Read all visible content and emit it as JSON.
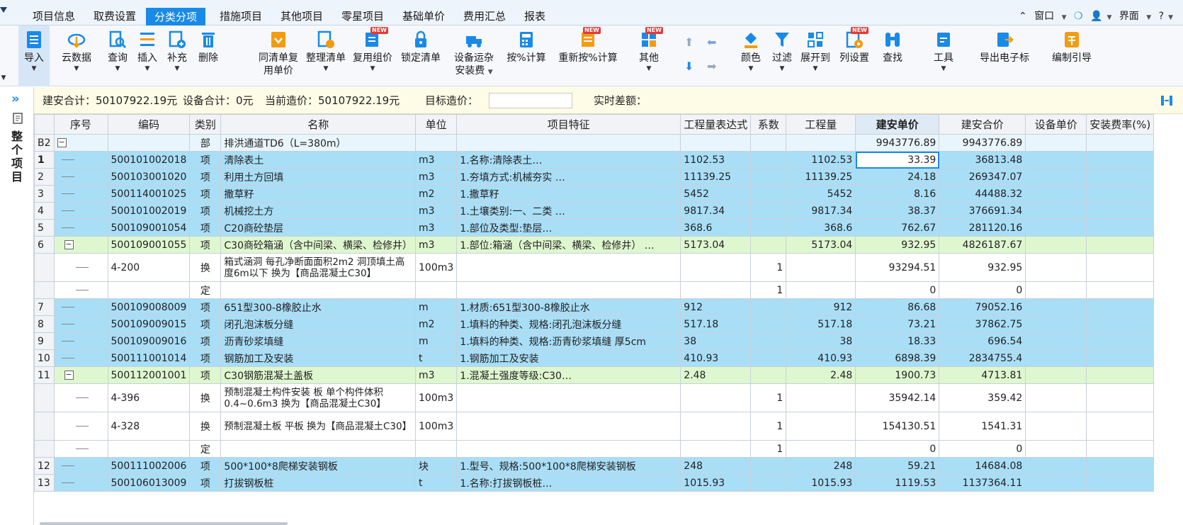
{
  "menu": {
    "tabs": [
      "项目信息",
      "取费设置",
      "分类分项",
      "措施项目",
      "其他项目",
      "零星项目",
      "基础单价",
      "费用汇总",
      "报表"
    ],
    "active_index": 2,
    "right": {
      "window": "窗口",
      "interface": "界面"
    }
  },
  "toolbar": {
    "import": "导入",
    "cloud": "云数据",
    "query": "查询",
    "insert": "插入",
    "supplement": "补充",
    "delete": "删除",
    "same_price_l1": "同清单复",
    "same_price_l2": "用单价",
    "organize": "整理清单",
    "reuse": "复用组价",
    "lock": "锁定清单",
    "equip_l1": "设备运杂",
    "equip_l2": "安装费",
    "percent": "按%计算",
    "recalc": "重新按%计算",
    "other": "其他",
    "color": "颜色",
    "filter": "过滤",
    "expand": "展开到",
    "columns": "列设置",
    "find": "查找",
    "tools": "工具",
    "export": "导出电子标",
    "guide": "编制引导",
    "new_badge": "NEW"
  },
  "summary": {
    "jian_an_label": "建安合计：",
    "jian_an_value": "50107922.19元",
    "equip_label": "设备合计：",
    "equip_value": "0元",
    "current_label": "当前造价：",
    "current_value": "50107922.19元",
    "target_label": "目标造价：",
    "diff_label": "实时差额："
  },
  "sidebar": {
    "label": "整个项目"
  },
  "table": {
    "headers": [
      "",
      "序号",
      "编码",
      "类别",
      "名称",
      "单位",
      "项目特征",
      "工程量表达式",
      "系数",
      "工程量",
      "建安单价",
      "建安合价",
      "设备单价",
      "安装费率(%)"
    ],
    "rows": [
      {
        "type": "bu",
        "rn": "B2",
        "seq": "",
        "code": "",
        "cat": "部",
        "name": "排洪通道TD6（L=380m）",
        "unit": "",
        "feature": "",
        "expr": "",
        "coef": "",
        "qty": "",
        "price": "9943776.89",
        "total": "9943776.89"
      },
      {
        "type": "xiang",
        "rn": "1",
        "code": "500101002018",
        "cat": "项",
        "name": "清除表土",
        "unit": "m3",
        "feature": "1.名称:清除表土…",
        "expr": "1102.53",
        "coef": "",
        "qty": "1102.53",
        "price": "33.39",
        "total": "36813.48"
      },
      {
        "type": "xiang",
        "rn": "2",
        "code": "500103001020",
        "cat": "项",
        "name": "利用土方回填",
        "unit": "m3",
        "feature": "1.夯填方式:机械夯实 …",
        "expr": "11139.25",
        "coef": "",
        "qty": "11139.25",
        "price": "24.18",
        "total": "269347.07"
      },
      {
        "type": "xiang",
        "rn": "3",
        "code": "500114001025",
        "cat": "项",
        "name": "撒草籽",
        "unit": "m2",
        "feature": "1.撒草籽",
        "expr": "5452",
        "coef": "",
        "qty": "5452",
        "price": "8.16",
        "total": "44488.32"
      },
      {
        "type": "xiang",
        "rn": "4",
        "code": "500101002019",
        "cat": "项",
        "name": "机械挖土方",
        "unit": "m3",
        "feature": "1.土壤类别:一、二类 …",
        "expr": "9817.34",
        "coef": "",
        "qty": "9817.34",
        "price": "38.37",
        "total": "376691.34"
      },
      {
        "type": "xiang",
        "rn": "5",
        "code": "500109001054",
        "cat": "项",
        "name": "C20商砼垫层",
        "unit": "m3",
        "feature": "1.部位及类型:垫层…",
        "expr": "368.6",
        "coef": "",
        "qty": "368.6",
        "price": "762.67",
        "total": "281120.16"
      },
      {
        "type": "green",
        "rn": "6",
        "code": "500109001055",
        "cat": "项",
        "name": "C30商砼箱涵（含中间梁、横梁、检修井）",
        "unit": "m3",
        "feature": "1.部位:箱涵（含中间梁、横梁、检修井） …",
        "expr": "5173.04",
        "coef": "",
        "qty": "5173.04",
        "price": "932.95",
        "total": "4826187.67"
      },
      {
        "type": "huan",
        "tall": true,
        "rn": "",
        "code": "4-200",
        "cat": "换",
        "name": "箱式涵洞 每孔净断面面积2m2 洞顶填土高度6m以下  换为【商品混凝土C30】",
        "unit": "100m3",
        "feature": "",
        "expr": "",
        "coef": "1",
        "qty": "",
        "price": "93294.51",
        "total": "932.95"
      },
      {
        "type": "huan",
        "rn": "",
        "code": "",
        "cat": "定",
        "name": "",
        "unit": "",
        "feature": "",
        "expr": "",
        "coef": "1",
        "qty": "",
        "price": "0",
        "total": "0"
      },
      {
        "type": "xiang",
        "rn": "7",
        "code": "500109008009",
        "cat": "项",
        "name": "651型300-8橡胶止水",
        "unit": "m",
        "feature": "1.材质:651型300-8橡胶止水",
        "expr": "912",
        "coef": "",
        "qty": "912",
        "price": "86.68",
        "total": "79052.16"
      },
      {
        "type": "xiang",
        "rn": "8",
        "code": "500109009015",
        "cat": "项",
        "name": "闭孔泡沫板分缝",
        "unit": "m2",
        "feature": "1.填料的种类、规格:闭孔泡沫板分缝",
        "expr": "517.18",
        "coef": "",
        "qty": "517.18",
        "price": "73.21",
        "total": "37862.75"
      },
      {
        "type": "xiang",
        "rn": "9",
        "code": "500109009016",
        "cat": "项",
        "name": "沥青砂浆填缝",
        "unit": "m",
        "feature": "1.填料的种类、规格:沥青砂浆填缝 厚5cm",
        "expr": "38",
        "coef": "",
        "qty": "38",
        "price": "18.33",
        "total": "696.54"
      },
      {
        "type": "xiang",
        "rn": "10",
        "code": "500111001014",
        "cat": "项",
        "name": "钢筋加工及安装",
        "unit": "t",
        "feature": "1.钢筋加工及安装",
        "expr": "410.93",
        "coef": "",
        "qty": "410.93",
        "price": "6898.39",
        "total": "2834755.4"
      },
      {
        "type": "green",
        "rn": "11",
        "code": "500112001001",
        "cat": "项",
        "name": "C30钢筋混凝土盖板",
        "unit": "m3",
        "feature": "1.混凝土强度等级:C30…",
        "expr": "2.48",
        "coef": "",
        "qty": "2.48",
        "price": "1900.73",
        "total": "4713.81"
      },
      {
        "type": "huan",
        "tall": true,
        "rn": "",
        "code": "4-396",
        "cat": "换",
        "name": "预制混凝土构件安装 板 单个构件体积0.4~0.6m3  换为【商品混凝土C30】",
        "unit": "100m3",
        "feature": "",
        "expr": "",
        "coef": "1",
        "qty": "",
        "price": "35942.14",
        "total": "359.42"
      },
      {
        "type": "huan",
        "tall": true,
        "rn": "",
        "code": "4-328",
        "cat": "换",
        "name": "预制混凝土板 平板  换为【商品混凝土C30】",
        "unit": "100m3",
        "feature": "",
        "expr": "",
        "coef": "1",
        "qty": "",
        "price": "154130.51",
        "total": "1541.31"
      },
      {
        "type": "huan",
        "rn": "",
        "code": "",
        "cat": "定",
        "name": "",
        "unit": "",
        "feature": "",
        "expr": "",
        "coef": "1",
        "qty": "",
        "price": "0",
        "total": "0"
      },
      {
        "type": "xiang",
        "rn": "12",
        "code": "500111002006",
        "cat": "项",
        "name": "500*100*8爬梯安装钢板",
        "unit": "块",
        "feature": "1.型号、规格:500*100*8爬梯安装钢板",
        "expr": "248",
        "coef": "",
        "qty": "248",
        "price": "59.21",
        "total": "14684.08"
      },
      {
        "type": "xiang",
        "rn": "13",
        "code": "500106013009",
        "cat": "项",
        "name": "打拔钢板桩",
        "unit": "t",
        "feature": "1.名称:打拔钢板桩…",
        "expr": "1015.93",
        "coef": "",
        "qty": "1015.93",
        "price": "1119.53",
        "total": "1137364.11"
      }
    ]
  },
  "colors": {
    "accent": "#1a8ae8",
    "xiang_row": "#a9def7",
    "green_row": "#dff7cf",
    "summary_bg": "#fefbe6"
  }
}
